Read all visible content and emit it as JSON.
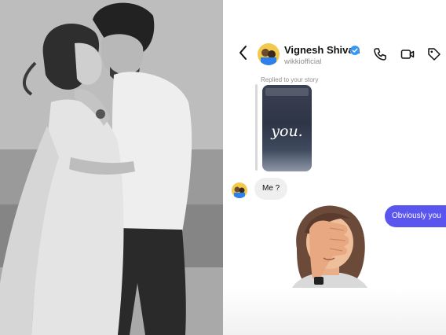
{
  "chat": {
    "contact_name": "Vignesh Shivan",
    "contact_handle": "wikkiofficial",
    "reply_label": "Replied to your story",
    "story_text": "you.",
    "incoming_message": "Me ?",
    "outgoing_message": "Obviously you"
  },
  "icons": {
    "back": "chevron-left-icon",
    "verified": "verified-badge-icon",
    "phone": "phone-icon",
    "video": "video-camera-icon",
    "tag": "tag-icon"
  },
  "colors": {
    "accent_bubble": "#5a55ee",
    "incoming_bubble": "#efefef",
    "verified": "#3897f0"
  }
}
